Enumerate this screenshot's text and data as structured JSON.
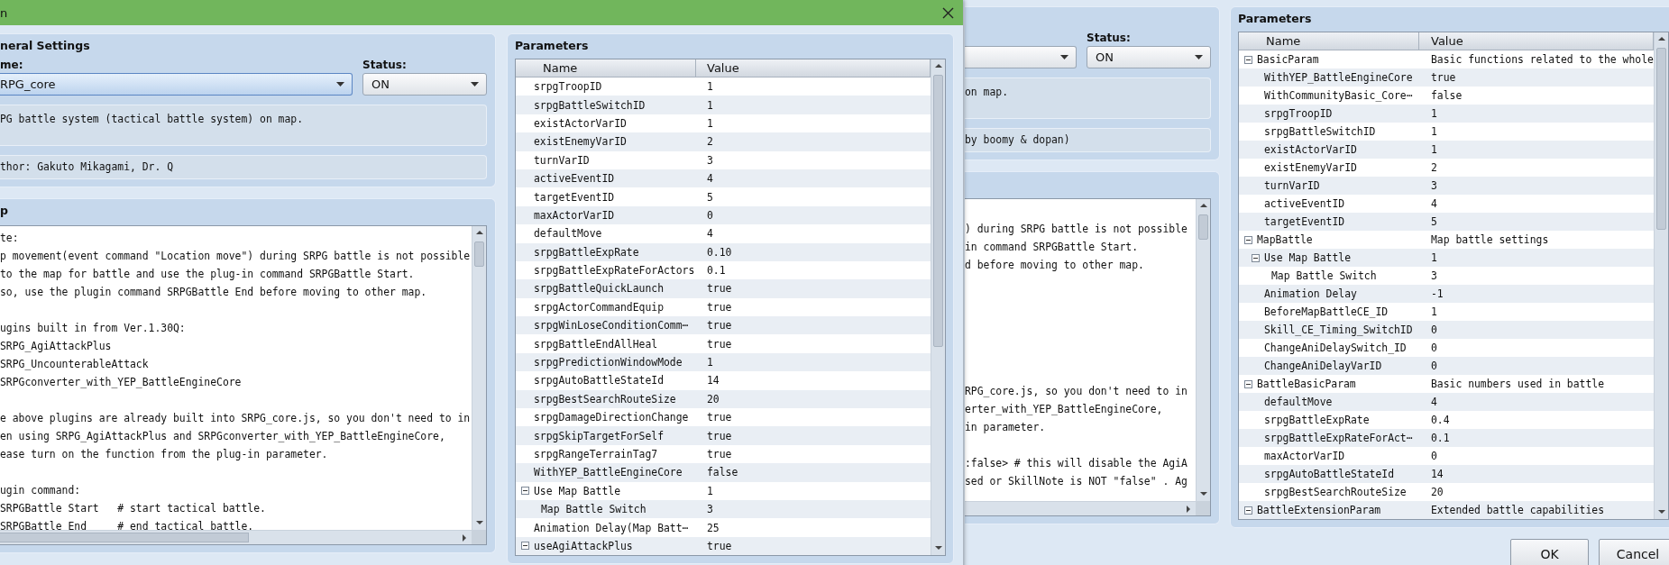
{
  "front_window": {
    "title": "n",
    "general_settings": {
      "title": "neral Settings",
      "name_label": "me:",
      "name_select": {
        "value": "RPG_core",
        "focused": true
      },
      "status_label": "Status:",
      "status_select": {
        "value": "ON",
        "focused": false
      },
      "description": "PG battle system (tactical battle system) on map.",
      "author": "thor: Gakuto Mikagami, Dr. Q"
    },
    "help": {
      "title": "p",
      "blocks": [
        {
          "lines": [
            "te:",
            "p movement(event command \"Location move\") during SRPG battle is not possible",
            "to the map for battle and use the plug-in command SRPGBattle Start.",
            "so, use the plugin command SRPGBattle End before moving to other map."
          ]
        },
        {
          "lines": [
            "ugins built in from Ver.1.30Q:",
            "SRPG_AgiAttackPlus",
            "SRPG_UncounterableAttack",
            "SRPGconverter_with_YEP_BattleEngineCore"
          ]
        },
        {
          "lines": [
            "e above plugins are already built into SRPG_core.js, so you don't need to in",
            "en using SRPG_AgiAttackPlus and SRPGconverter_with_YEP_BattleEngineCore,",
            "ease turn on the function from the plug-in parameter."
          ]
        },
        {
          "lines": [
            "ugin command:",
            "SRPGBattle Start   # start tactical battle.",
            "SRPGBattle End     # end tactical battle."
          ]
        }
      ]
    },
    "parameters": {
      "title": "Parameters",
      "columns": [
        "Name",
        "Value"
      ],
      "rows": [
        {
          "name": "srpgTroopID",
          "value": "1"
        },
        {
          "name": "srpgBattleSwitchID",
          "value": "1"
        },
        {
          "name": "existActorVarID",
          "value": "1"
        },
        {
          "name": "existEnemyVarID",
          "value": "2"
        },
        {
          "name": "turnVarID",
          "value": "3"
        },
        {
          "name": "activeEventID",
          "value": "4"
        },
        {
          "name": "targetEventID",
          "value": "5"
        },
        {
          "name": "maxActorVarID",
          "value": "0"
        },
        {
          "name": "defaultMove",
          "value": "4"
        },
        {
          "name": "srpgBattleExpRate",
          "value": "0.10"
        },
        {
          "name": "srpgBattleExpRateForActors",
          "value": "0.1"
        },
        {
          "name": "srpgBattleQuickLaunch",
          "value": "true"
        },
        {
          "name": "srpgActorCommandEquip",
          "value": "true"
        },
        {
          "name": "srpgWinLoseConditionComm⋯",
          "value": "true"
        },
        {
          "name": "srpgBattleEndAllHeal",
          "value": "true"
        },
        {
          "name": "srpgPredictionWindowMode",
          "value": "1"
        },
        {
          "name": "srpgAutoBattleStateId",
          "value": "14"
        },
        {
          "name": "srpgBestSearchRouteSize",
          "value": "20"
        },
        {
          "name": "srpgDamageDirectionChange",
          "value": "true"
        },
        {
          "name": "srpgSkipTargetForSelf",
          "value": "true"
        },
        {
          "name": "srpgRangeTerrainTag7",
          "value": "true"
        },
        {
          "name": "WithYEP_BattleEngineCore",
          "value": "false"
        },
        {
          "name": "Use Map Battle",
          "value": "1",
          "expanded": true,
          "children": [
            {
              "name": "Map Battle Switch",
              "value": "3"
            }
          ]
        },
        {
          "name": "Animation Delay(Map Batt⋯",
          "value": "25"
        },
        {
          "name": "useAgiAttackPlus",
          "value": "true",
          "expanded": true
        }
      ]
    }
  },
  "back_window": {
    "general_settings": {
      "name_select": {
        "focused": false
      },
      "status_label": "Status:",
      "status_select": {
        "value": "ON",
        "focused": false
      },
      "description": "on map.",
      "author": "by boomy & dopan)"
    },
    "help": {
      "blocks": [
        {
          "lines": [
            ") during SRPG battle is not possible",
            "in command SRPGBattle Start.",
            "d before moving to other map."
          ]
        },
        {
          "lines": [
            "RPG_core.js, so you don't need to in",
            "erter_with_YEP_BattleEngineCore,",
            "in parameter."
          ]
        },
        {
          "lines": [
            ":false> # this will disable the AgiA",
            "sed or SkillNote is NOT \"false\" . Ag"
          ]
        }
      ]
    },
    "parameters": {
      "title": "Parameters",
      "columns": [
        "Name",
        "Value"
      ],
      "rows": [
        {
          "name": "BasicParam",
          "value": "Basic functions related to the whole",
          "expanded": true,
          "children": [
            {
              "name": "WithYEP_BattleEngineCore",
              "value": "true"
            },
            {
              "name": "WithCommunityBasic_Core⋯",
              "value": "false"
            },
            {
              "name": "srpgTroopID",
              "value": "1"
            },
            {
              "name": "srpgBattleSwitchID",
              "value": "1"
            },
            {
              "name": "existActorVarID",
              "value": "1"
            },
            {
              "name": "existEnemyVarID",
              "value": "2"
            },
            {
              "name": "turnVarID",
              "value": "3"
            },
            {
              "name": "activeEventID",
              "value": "4"
            },
            {
              "name": "targetEventID",
              "value": "5"
            }
          ]
        },
        {
          "name": "MapBattle",
          "value": "Map battle settings",
          "expanded": true,
          "children": [
            {
              "name": "Use Map Battle",
              "value": "1",
              "expanded": true,
              "children": [
                {
                  "name": "Map Battle Switch",
                  "value": "3"
                }
              ]
            },
            {
              "name": "Animation Delay",
              "value": "-1"
            },
            {
              "name": "BeforeMapBattleCE_ID",
              "value": "1"
            },
            {
              "name": "Skill_CE_Timing_SwitchID",
              "value": "0"
            },
            {
              "name": "ChangeAniDelaySwitch_ID",
              "value": "0"
            },
            {
              "name": "ChangeAniDelayVarID",
              "value": "0"
            }
          ]
        },
        {
          "name": "BattleBasicParam",
          "value": "Basic numbers used in battle",
          "expanded": true,
          "children": [
            {
              "name": "defaultMove",
              "value": "4"
            },
            {
              "name": "srpgBattleExpRate",
              "value": "0.4"
            },
            {
              "name": "srpgBattleExpRateForAct⋯",
              "value": "0.1"
            },
            {
              "name": "maxActorVarID",
              "value": "0"
            },
            {
              "name": "srpgAutoBattleStateId",
              "value": "14"
            },
            {
              "name": "srpgBestSearchRouteSize",
              "value": "20"
            }
          ]
        },
        {
          "name": "BattleExtensionParam",
          "value": "Extended battle capabilities",
          "expanded": true
        }
      ]
    },
    "buttons": [
      "OK",
      "Cancel"
    ]
  }
}
